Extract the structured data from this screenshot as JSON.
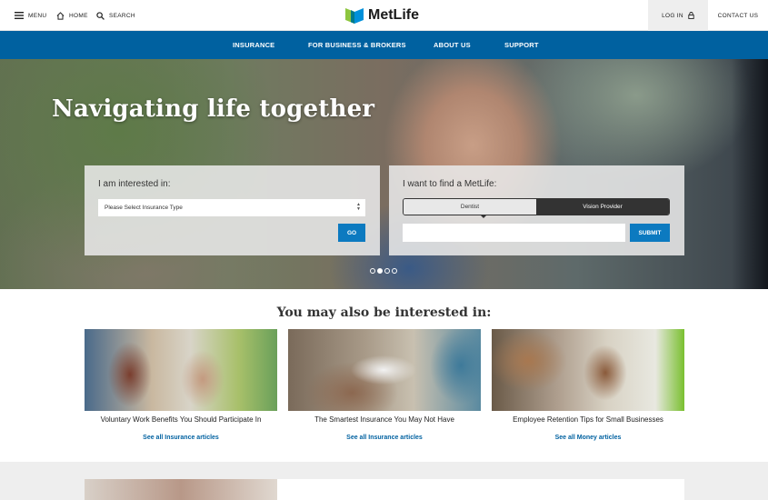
{
  "header": {
    "menu_label": "MENU",
    "home_label": "HOME",
    "search_label": "SEARCH",
    "logo_text": "MetLife",
    "login_label": "LOG IN",
    "contact_label": "CONTACT US"
  },
  "nav": {
    "items": [
      "INSURANCE",
      "FOR BUSINESS & BROKERS",
      "ABOUT US",
      "SUPPORT"
    ]
  },
  "hero": {
    "title": "Navigating life together",
    "interest_label": "I am interested in:",
    "select_value": "Please Select Insurance Type",
    "go_label": "GO",
    "find_label": "I want to find a MetLife:",
    "toggle_options": [
      "Dentist",
      "Vision Provider"
    ],
    "find_input_value": "",
    "submit_label": "SUBMIT",
    "carousel_total": 4,
    "carousel_active": 2
  },
  "related": {
    "title": "You may also be interested in:",
    "articles": [
      {
        "title": "Voluntary Work Benefits You Should Participate In",
        "link": "See all Insurance articles"
      },
      {
        "title": "The Smartest Insurance You May Not Have",
        "link": "See all Insurance articles"
      },
      {
        "title": "Employee Retention Tips for Small Businesses",
        "link": "See all Money articles"
      }
    ]
  },
  "colors": {
    "brand_blue": "#0061a0",
    "button_blue": "#0c7ac0",
    "logo_green": "#8dc63f",
    "logo_blue": "#0090da"
  }
}
